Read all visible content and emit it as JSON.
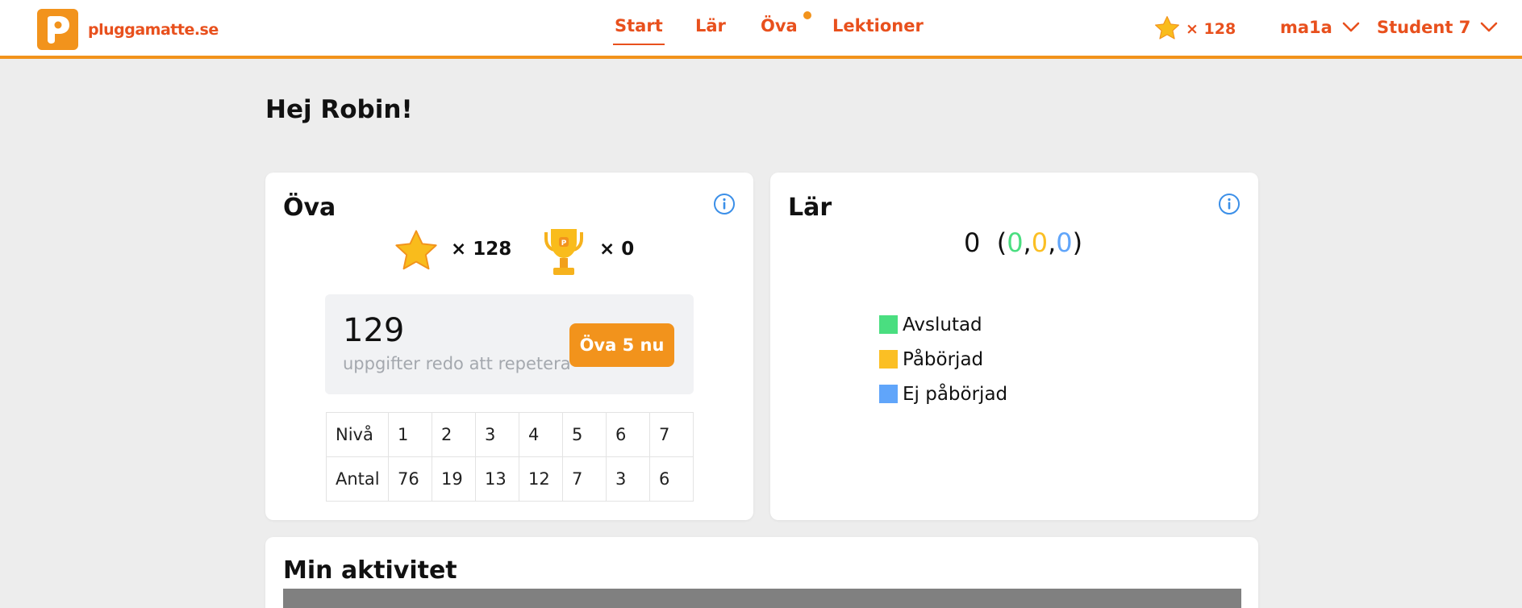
{
  "header": {
    "logo_text": "pluggamatte.se",
    "nav": [
      {
        "label": "Start",
        "active": true
      },
      {
        "label": "Lär",
        "active": false
      },
      {
        "label": "Öva",
        "active": false,
        "has_notification": true
      },
      {
        "label": "Lektioner",
        "active": false
      }
    ],
    "stars_label": "× 128",
    "course": "ma1a",
    "user": "Student 7"
  },
  "greeting": "Hej Robin!",
  "ova": {
    "title": "Öva",
    "stars": "× 128",
    "trophies": "× 0",
    "repeat_count": "129",
    "repeat_label": "uppgifter redo att repetera",
    "button_label": "Öva 5 nu",
    "levels": {
      "header_label": "Nivå",
      "count_label": "Antal",
      "levels": [
        "1",
        "2",
        "3",
        "4",
        "5",
        "6",
        "7"
      ],
      "counts": [
        "76",
        "19",
        "13",
        "12",
        "7",
        "3",
        "6"
      ]
    }
  },
  "lar": {
    "title": "Lär",
    "total": "0",
    "finished": "0",
    "started": "0",
    "not_started": "0",
    "legend": [
      "Avslutad",
      "Påbörjad",
      "Ej påbörjad"
    ],
    "colors": {
      "finished": "#4ade80",
      "started": "#fbbf24",
      "not_started": "#60a5fa"
    }
  },
  "aktivitet": {
    "title": "Min aktivitet"
  },
  "colors": {
    "accent": "#f2931c",
    "brand_text": "#e8501d",
    "background": "#ededed"
  },
  "icons": [
    "logo-icon",
    "star-icon",
    "chevron-down-icon",
    "info-icon",
    "trophy-icon"
  ]
}
